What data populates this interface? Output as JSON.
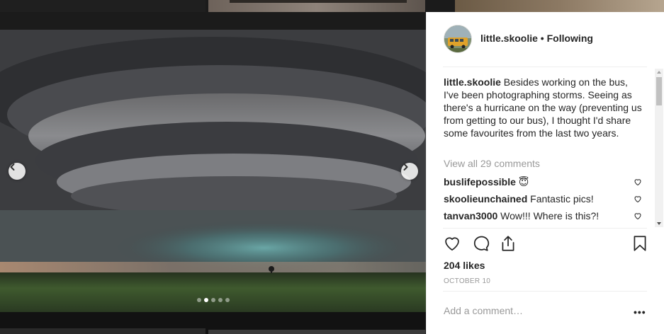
{
  "post": {
    "username": "little.skoolie",
    "separator": " • ",
    "follow_status": "Following",
    "caption_user": "little.skoolie",
    "caption_text": " Besides working on the bus, I've been photographing storms. Seeing as there's a hurricane on the way (preventing us from getting to our bus), I thought I'd share some favourites from the last two years.",
    "view_all_comments": "View all 29 comments",
    "comments": [
      {
        "user": "buslifepossible",
        "text": " 😇"
      },
      {
        "user": "skoolieunchained",
        "text": " Fantastic pics!"
      },
      {
        "user": "tanvan3000",
        "text": " Wow!!! Where is this?!"
      }
    ],
    "likes": "204 likes",
    "date": "OCTOBER 10",
    "add_comment_placeholder": "Add a comment…",
    "more_label": "•••"
  },
  "carousel": {
    "total_slides": 5,
    "active_slide": 2
  },
  "icons": {
    "prev": "chevron-left-icon",
    "next": "chevron-right-icon",
    "like": "heart-icon",
    "comment": "comment-bubble-icon",
    "share": "share-icon",
    "save": "bookmark-icon"
  },
  "colors": {
    "text": "#262626",
    "muted": "#999999",
    "divider": "#efefef"
  }
}
